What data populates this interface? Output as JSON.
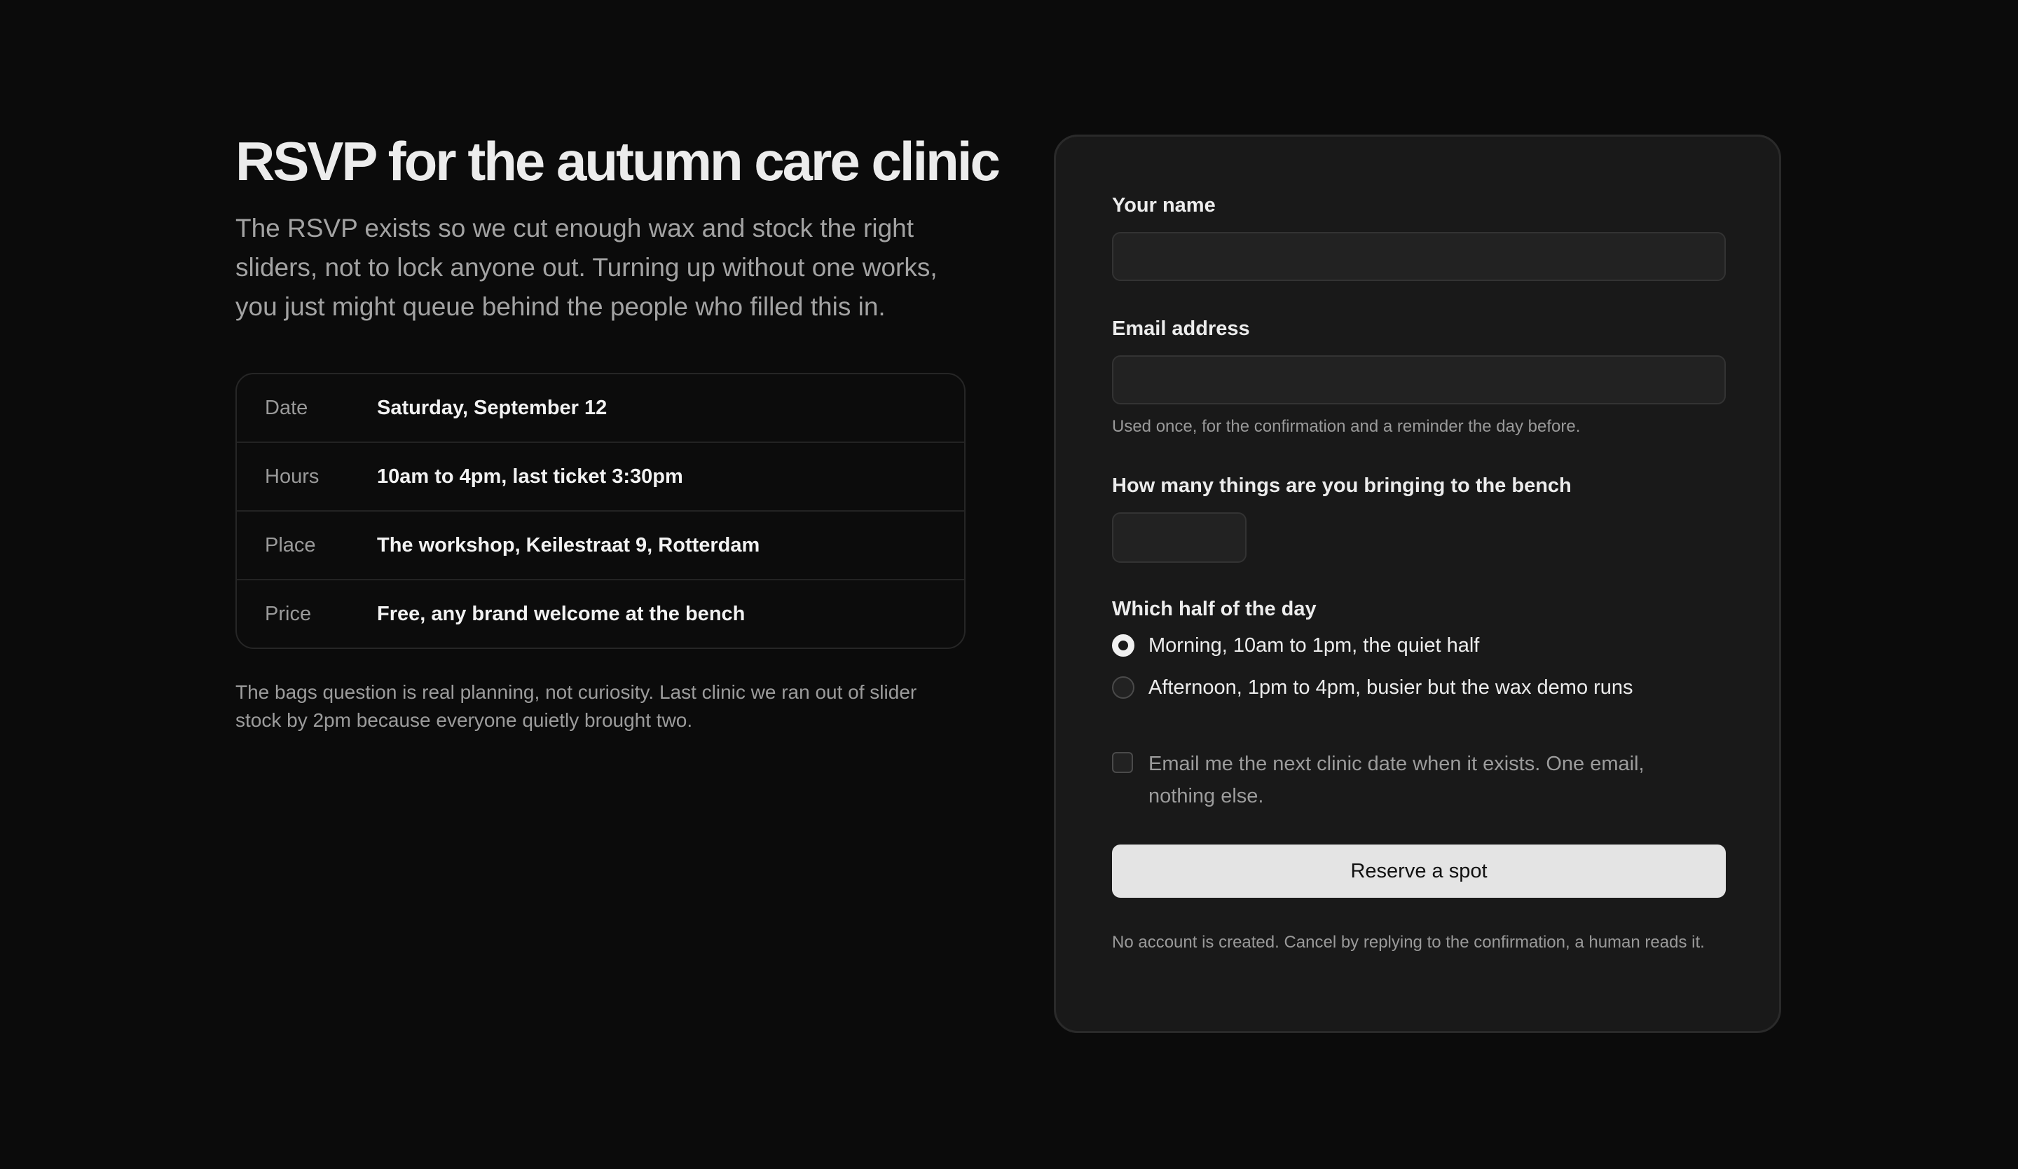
{
  "intro": {
    "title": "RSVP for the autumn care clinic",
    "lede": "The RSVP exists so we cut enough wax and stock the right sliders, not to lock anyone out. Turning up without one works, you just might queue behind the people who filled this in.",
    "details": [
      {
        "label": "Date",
        "value": "Saturday, September 12"
      },
      {
        "label": "Hours",
        "value": "10am to 4pm, last ticket 3:30pm"
      },
      {
        "label": "Place",
        "value": "The workshop, Keilestraat 9, Rotterdam"
      },
      {
        "label": "Price",
        "value": "Free, any brand welcome at the bench"
      }
    ],
    "note": "The bags question is real planning, not curiosity. Last clinic we ran out of slider stock by 2pm because everyone quietly brought two."
  },
  "form": {
    "name": {
      "label": "Your name",
      "value": "",
      "placeholder": ""
    },
    "email": {
      "label": "Email address",
      "value": "",
      "placeholder": "",
      "hint": "Used once, for the confirmation and a reminder the day before."
    },
    "count": {
      "label": "How many things are you bringing to the bench",
      "value": ""
    },
    "half": {
      "label": "Which half of the day",
      "selected": "morning",
      "options": [
        {
          "id": "morning",
          "label": "Morning, 10am to 1pm, the quiet half"
        },
        {
          "id": "afternoon",
          "label": "Afternoon, 1pm to 4pm, busier but the wax demo runs"
        }
      ]
    },
    "notify": {
      "label": "Email me the next clinic date when it exists. One email, nothing else.",
      "checked": false
    },
    "submit_label": "Reserve a spot",
    "fineprint": "No account is created. Cancel by replying to the confirmation, a human reads it."
  }
}
